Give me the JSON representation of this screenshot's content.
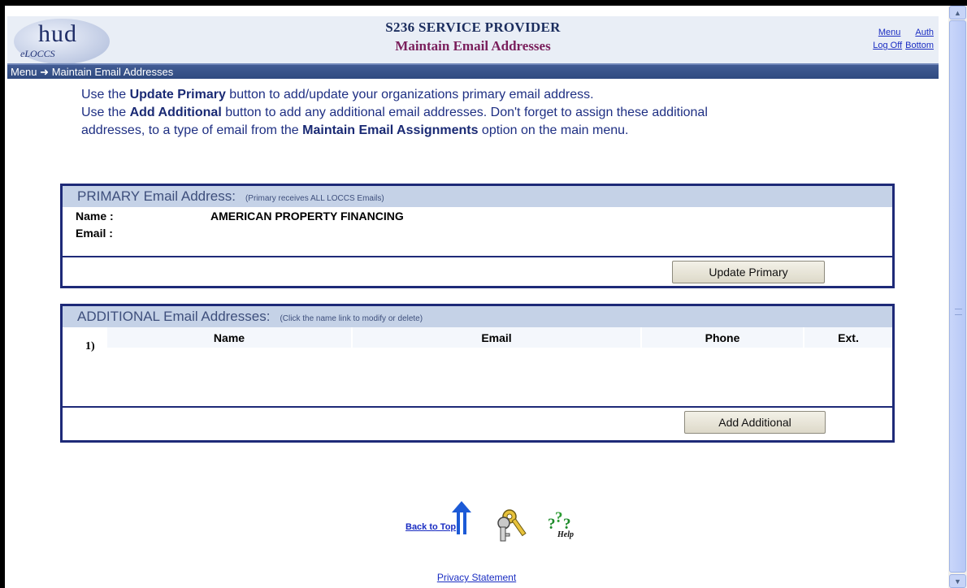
{
  "header": {
    "logo_text": "hud",
    "logo_sub": "eLOCCS",
    "title": "S236 SERVICE PROVIDER",
    "subtitle": "Maintain Email Addresses",
    "links": {
      "menu": "Menu",
      "auth": "Auth",
      "logoff": "Log Off",
      "bottom": "Bottom"
    }
  },
  "breadcrumb": {
    "menu": "Menu",
    "arrow": "➜",
    "current": "Maintain Email Addresses"
  },
  "intro": {
    "line1_pre": "Use the ",
    "line1_bold": "Update Primary",
    "line1_post": " button to add/update your organizations primary email address.",
    "line2_pre": "Use the ",
    "line2_bold": "Add Additional",
    "line2_post": " button to add any additional email addresses. Don't forget to assign these additional",
    "line3_pre": "addresses, to a type of email from the ",
    "line3_bold": "Maintain Email Assignments",
    "line3_post": " option on the main menu."
  },
  "primary": {
    "title": "PRIMARY Email Address:",
    "note": "(Primary receives ALL LOCCS Emails)",
    "name_label": "Name :",
    "name_value": "AMERICAN PROPERTY FINANCING",
    "email_label": "Email :",
    "email_value": "",
    "button": "Update Primary"
  },
  "additional": {
    "title": "ADDITIONAL Email Addresses:",
    "note": "(Click the name link to modify or delete)",
    "columns": [
      "Name",
      "Email",
      "Phone",
      "Ext."
    ],
    "rows": [
      {
        "num": "1)"
      }
    ],
    "button": "Add Additional"
  },
  "footer": {
    "back_to_top": "Back to Top",
    "help": "Help",
    "privacy": "Privacy Statement"
  }
}
